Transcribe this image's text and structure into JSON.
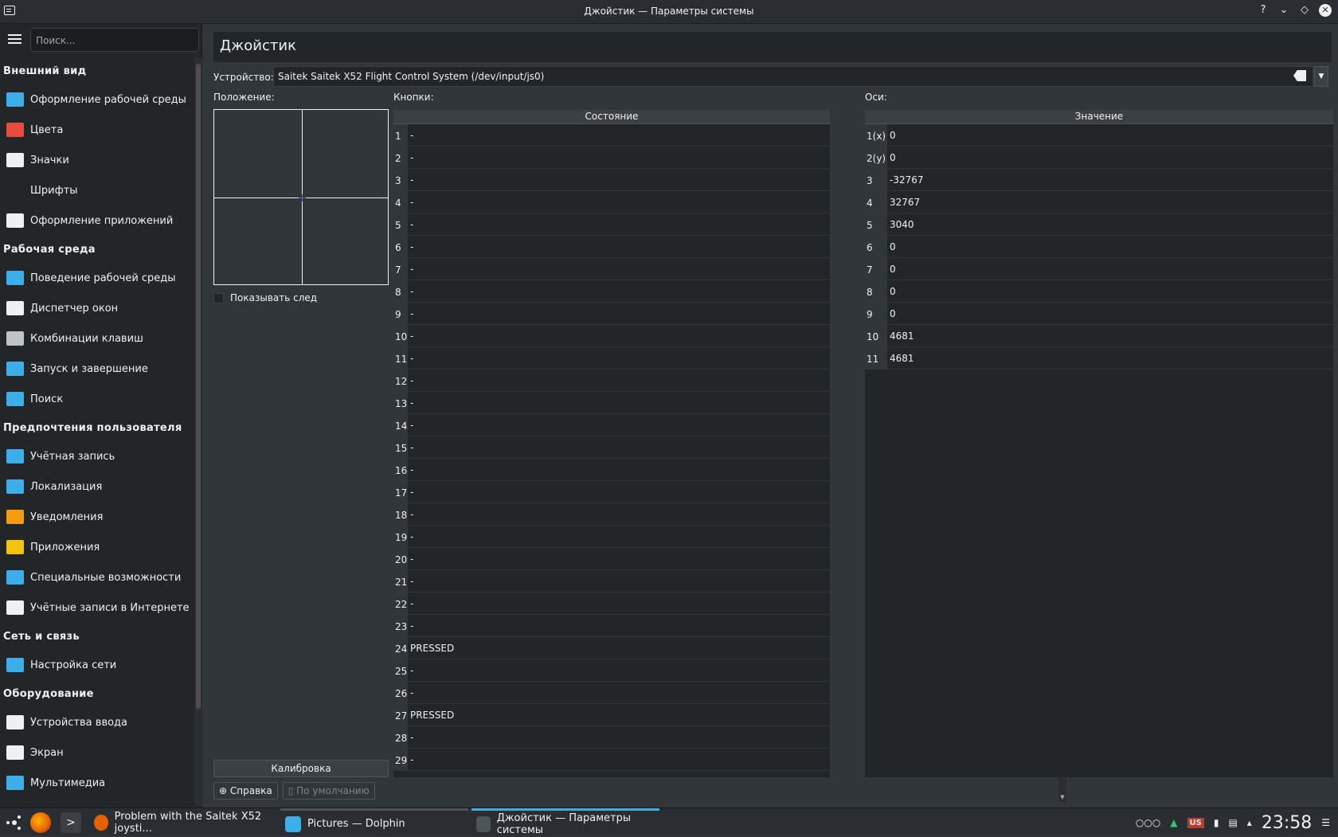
{
  "window": {
    "title": "Джойстик — Параметры системы"
  },
  "sidebar": {
    "search_placeholder": "Поиск...",
    "sections": [
      {
        "title": "Внешний вид",
        "items": [
          {
            "label": "Оформление рабочей среды",
            "color": "#3daee9"
          },
          {
            "label": "Цвета",
            "color": "#e74c3c"
          },
          {
            "label": "Значки",
            "color": "#eff0f1"
          },
          {
            "label": "Шрифты",
            "color": "#232629"
          },
          {
            "label": "Оформление приложений",
            "color": "#eff0f1"
          }
        ]
      },
      {
        "title": "Рабочая среда",
        "items": [
          {
            "label": "Поведение рабочей среды",
            "color": "#3daee9"
          },
          {
            "label": "Диспетчер окон",
            "color": "#eff0f1"
          },
          {
            "label": "Комбинации клавиш",
            "color": "#bdc3c7"
          },
          {
            "label": "Запуск и завершение",
            "color": "#3daee9"
          },
          {
            "label": "Поиск",
            "color": "#3daee9"
          }
        ]
      },
      {
        "title": "Предпочтения пользователя",
        "items": [
          {
            "label": "Учётная запись",
            "color": "#3daee9"
          },
          {
            "label": "Локализация",
            "color": "#3daee9"
          },
          {
            "label": "Уведомления",
            "color": "#f39c12"
          },
          {
            "label": "Приложения",
            "color": "#f1c40f"
          },
          {
            "label": "Специальные возможности",
            "color": "#3daee9"
          },
          {
            "label": "Учётные записи в Интернете",
            "color": "#eff0f1"
          }
        ]
      },
      {
        "title": "Сеть и связь",
        "items": [
          {
            "label": "Настройка сети",
            "color": "#3daee9"
          }
        ]
      },
      {
        "title": "Оборудование",
        "items": [
          {
            "label": "Устройства ввода",
            "color": "#eff0f1"
          },
          {
            "label": "Экран",
            "color": "#eff0f1"
          },
          {
            "label": "Мультимедиа",
            "color": "#3daee9"
          }
        ]
      }
    ]
  },
  "page": {
    "header": "Джойстик",
    "device_label": "Устройство:",
    "device_value": "Saitek Saitek X52 Flight Control System (/dev/input/js0)",
    "position_label": "Положение:",
    "show_trace_label": "Показывать след",
    "calibrate_label": "Калибровка",
    "buttons_label": "Кнопки:",
    "buttons_header": "Состояние",
    "buttons": [
      {
        "n": "1",
        "v": "-"
      },
      {
        "n": "2",
        "v": "-"
      },
      {
        "n": "3",
        "v": "-"
      },
      {
        "n": "4",
        "v": "-"
      },
      {
        "n": "5",
        "v": "-"
      },
      {
        "n": "6",
        "v": "-"
      },
      {
        "n": "7",
        "v": "-"
      },
      {
        "n": "8",
        "v": "-"
      },
      {
        "n": "9",
        "v": "-"
      },
      {
        "n": "10",
        "v": "-"
      },
      {
        "n": "11",
        "v": "-"
      },
      {
        "n": "12",
        "v": "-"
      },
      {
        "n": "13",
        "v": "-"
      },
      {
        "n": "14",
        "v": "-"
      },
      {
        "n": "15",
        "v": "-"
      },
      {
        "n": "16",
        "v": "-"
      },
      {
        "n": "17",
        "v": "-"
      },
      {
        "n": "18",
        "v": "-"
      },
      {
        "n": "19",
        "v": "-"
      },
      {
        "n": "20",
        "v": "-"
      },
      {
        "n": "21",
        "v": "-"
      },
      {
        "n": "22",
        "v": "-"
      },
      {
        "n": "23",
        "v": "-"
      },
      {
        "n": "24",
        "v": "PRESSED"
      },
      {
        "n": "25",
        "v": "-"
      },
      {
        "n": "26",
        "v": "-"
      },
      {
        "n": "27",
        "v": "PRESSED"
      },
      {
        "n": "28",
        "v": "-"
      },
      {
        "n": "29",
        "v": "-"
      }
    ],
    "axes_label": "Оси:",
    "axes_header": "Значение",
    "axes": [
      {
        "n": "1(x)",
        "v": "0"
      },
      {
        "n": "2(y)",
        "v": "0"
      },
      {
        "n": "3",
        "v": "-32767"
      },
      {
        "n": "4",
        "v": "32767"
      },
      {
        "n": "5",
        "v": "3040"
      },
      {
        "n": "6",
        "v": "0"
      },
      {
        "n": "7",
        "v": "0"
      },
      {
        "n": "8",
        "v": "0"
      },
      {
        "n": "9",
        "v": "0"
      },
      {
        "n": "10",
        "v": "4681"
      },
      {
        "n": "11",
        "v": "4681"
      }
    ],
    "help_label": "Справка",
    "defaults_label": "По умолчанию"
  },
  "taskbar": {
    "tasks": [
      {
        "label": "Problem with the Saitek X52 joysti...",
        "color": "#e66000"
      },
      {
        "label": "Pictures — Dolphin",
        "color": "#3daee9"
      },
      {
        "label": "Джойстик  — Параметры системы",
        "color": "#4d545a"
      }
    ],
    "clock": "23:58",
    "layout": "US"
  }
}
